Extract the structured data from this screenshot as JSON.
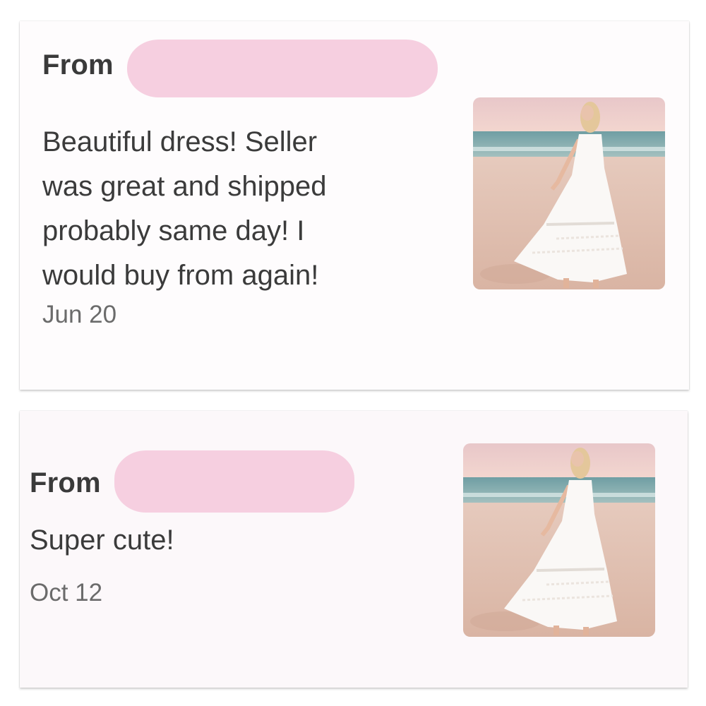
{
  "reviews": [
    {
      "from_label": "From",
      "text_lines": [
        "Beautiful dress! Seller",
        "was great and shipped",
        "probably same day! I",
        "would buy from again!"
      ],
      "date": "Jun 20",
      "image_icon": "dress-photo"
    },
    {
      "from_label": "From",
      "text_lines": [
        "Super cute!"
      ],
      "date": "Oct 12",
      "image_icon": "dress-photo"
    }
  ],
  "colors": {
    "redaction": "#f6cfe0",
    "text": "#3b3b3b",
    "date": "#6b6b6b"
  }
}
